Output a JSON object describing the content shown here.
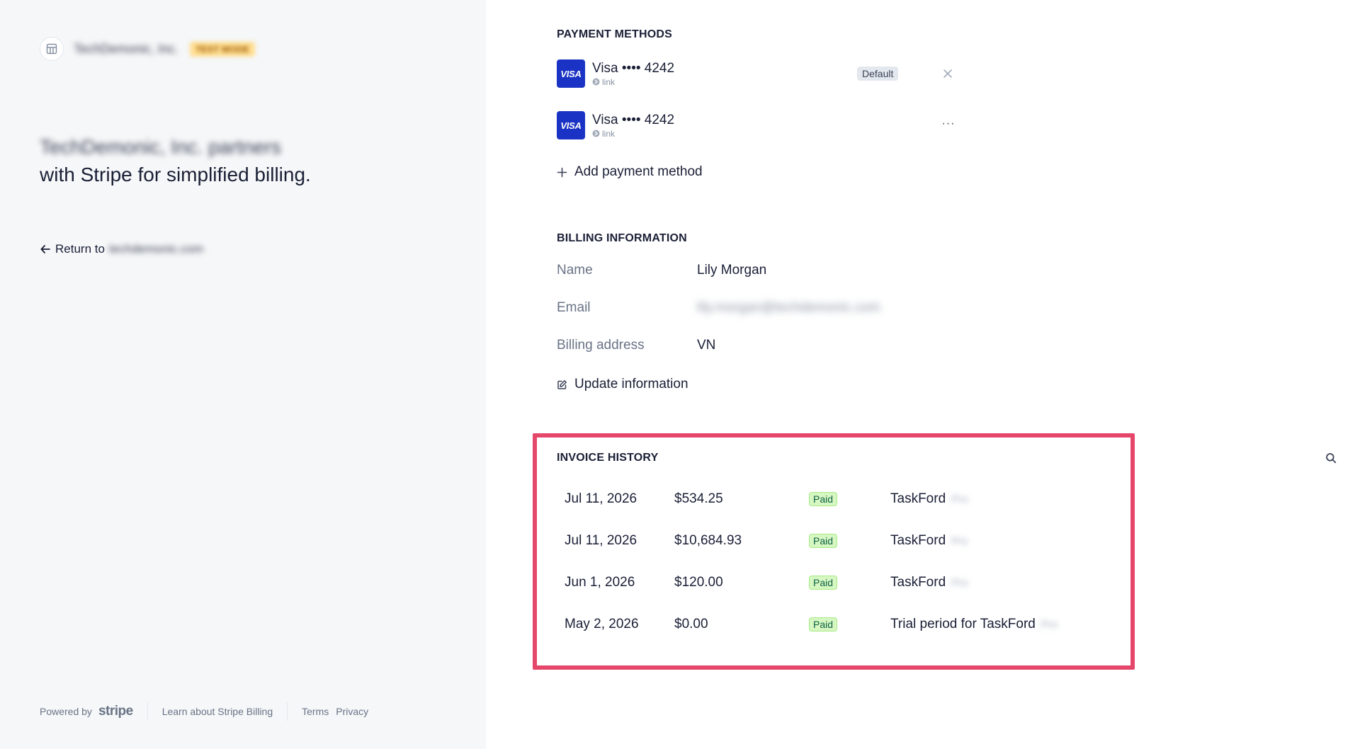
{
  "left": {
    "merchant_name": "TechDemonic, Inc.",
    "test_badge": "TEST MODE",
    "tagline_blurred": "TechDemonic, Inc. partners",
    "tagline": "with Stripe for simplified billing.",
    "return_label": "Return to",
    "return_target": "techdemonic.com",
    "footer": {
      "powered_by": "Powered by",
      "stripe": "stripe",
      "learn": "Learn about Stripe Billing",
      "terms": "Terms",
      "privacy": "Privacy"
    }
  },
  "payment_methods": {
    "heading": "PAYMENT METHODS",
    "items": [
      {
        "brand": "VISA",
        "label": "Visa •••• 4242",
        "sub": "link",
        "badge": "Default"
      },
      {
        "brand": "VISA",
        "label": "Visa •••• 4242",
        "sub": "link",
        "more": "···"
      }
    ],
    "add_label": "Add payment method"
  },
  "billing": {
    "heading": "BILLING INFORMATION",
    "rows": [
      {
        "label": "Name",
        "value": "Lily Morgan"
      },
      {
        "label": "Email",
        "value": "lily.morgan@techdemonic.com"
      },
      {
        "label": "Billing address",
        "value": "VN"
      }
    ],
    "update_label": "Update information"
  },
  "invoices": {
    "heading": "INVOICE HISTORY",
    "rows": [
      {
        "date": "Jul 11, 2026",
        "amount": "$534.25",
        "status": "Paid",
        "description": "TaskFord",
        "extra": "Pro"
      },
      {
        "date": "Jul 11, 2026",
        "amount": "$10,684.93",
        "status": "Paid",
        "description": "TaskFord",
        "extra": "Pro"
      },
      {
        "date": "Jun 1, 2026",
        "amount": "$120.00",
        "status": "Paid",
        "description": "TaskFord",
        "extra": "Pro"
      },
      {
        "date": "May 2, 2026",
        "amount": "$0.00",
        "status": "Paid",
        "description": "Trial period for TaskFord",
        "extra": "Pro"
      }
    ]
  },
  "colors": {
    "left_bg": "#f5f7f8",
    "visa_blue": "#1a33c4",
    "highlight": "#e5476b",
    "paid_green": "#0e6245"
  }
}
